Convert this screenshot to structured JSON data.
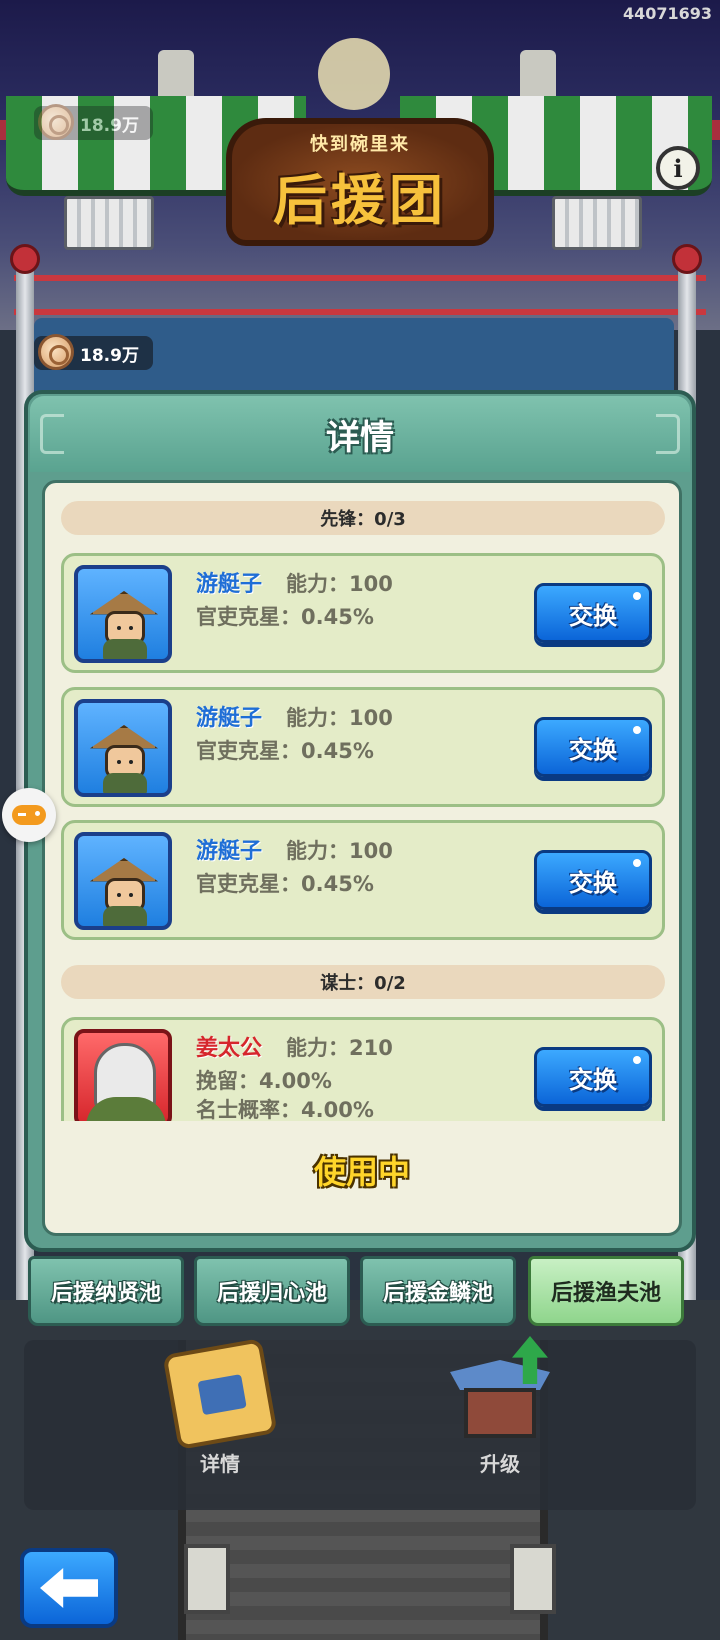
{
  "header": {
    "id_text": "44071693",
    "coins_top": "18.9万",
    "coins": "18.9万",
    "sign_subtitle": "快到碗里来",
    "sign_title": "后援团"
  },
  "modal": {
    "title": "详情",
    "sections": [
      {
        "label": "先锋：0/3"
      },
      {
        "label": "谋士：0/2"
      }
    ],
    "cards": [
      {
        "name": "游艇子",
        "ability": "能力：100",
        "stat1": "官吏克星：0.45%",
        "stat2": "",
        "button": "交换",
        "rarity": "blue"
      },
      {
        "name": "游艇子",
        "ability": "能力：100",
        "stat1": "官吏克星：0.45%",
        "stat2": "",
        "button": "交换",
        "rarity": "blue"
      },
      {
        "name": "游艇子",
        "ability": "能力：100",
        "stat1": "官吏克星：0.45%",
        "stat2": "",
        "button": "交换",
        "rarity": "blue"
      },
      {
        "name": "姜太公",
        "ability": "能力：210",
        "stat1": "挽留：4.00%",
        "stat2": "名士概率：4.00%",
        "button": "交换",
        "rarity": "red"
      }
    ],
    "status": "使用中"
  },
  "tabs": [
    {
      "label": "后援纳贤池",
      "active": false
    },
    {
      "label": "后援归心池",
      "active": false
    },
    {
      "label": "后援金鳞池",
      "active": false
    },
    {
      "label": "后援渔夫池",
      "active": true
    }
  ],
  "actions": {
    "details_label": "详情",
    "upgrade_label": "升级"
  },
  "icons": {
    "coin": "coin-icon",
    "info": "info-icon",
    "gamepad": "gamepad-icon",
    "back": "back-arrow-icon"
  },
  "colors": {
    "accent_blue": "#1f7fe0",
    "rarity_red": "#d6262c",
    "modal_teal": "#5e9e8e",
    "in_use_yellow": "#ffd52a"
  }
}
